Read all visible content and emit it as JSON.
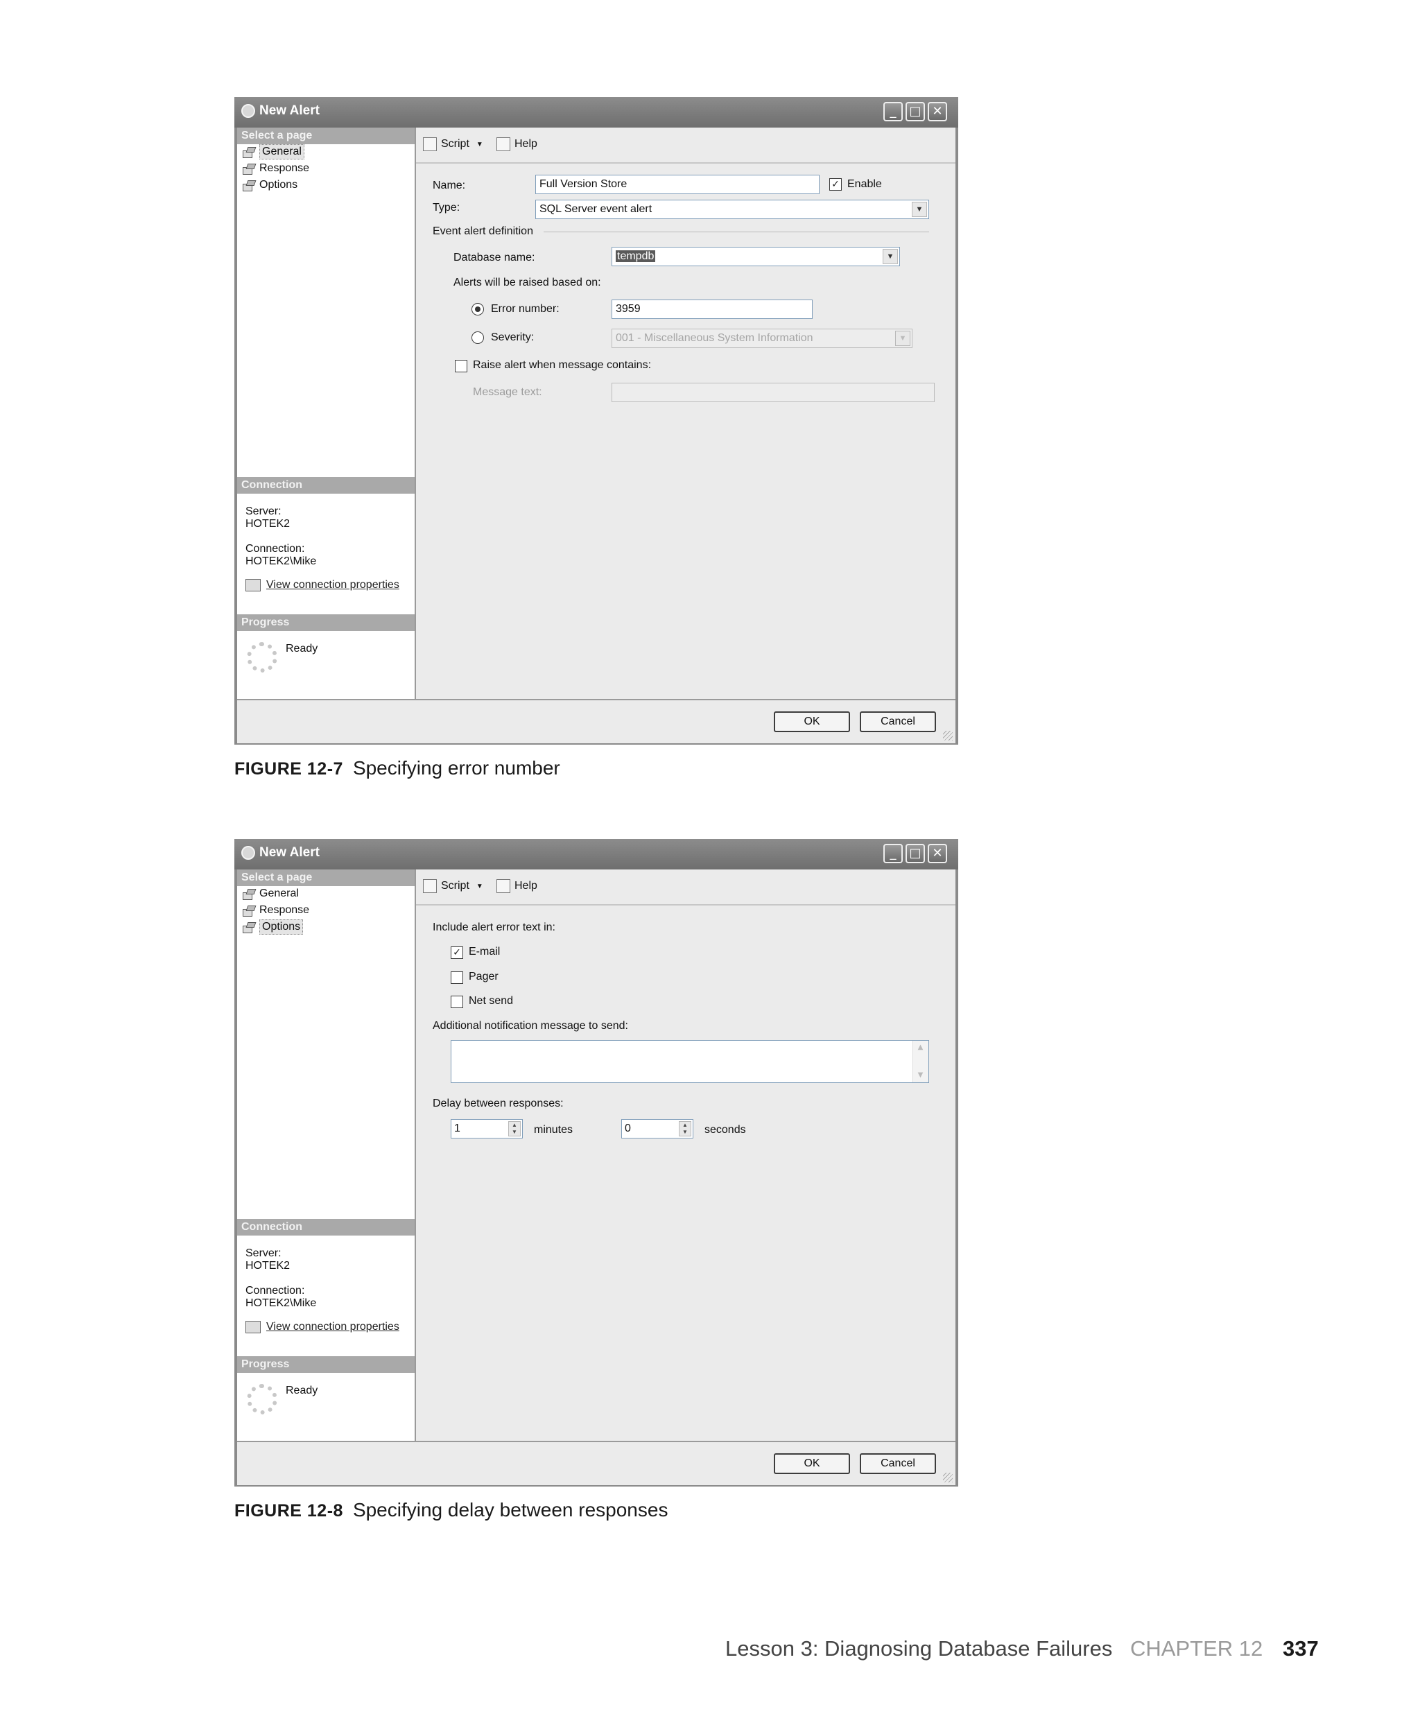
{
  "figure1": {
    "window_title": "New Alert",
    "select_page_header": "Select a page",
    "pages": [
      "General",
      "Response",
      "Options"
    ],
    "selected_page": "General",
    "toolbar": {
      "script_label": "Script",
      "help_label": "Help"
    },
    "connection_header": "Connection",
    "server_label": "Server:",
    "server_value": "HOTEK2",
    "connection_label": "Connection:",
    "connection_value": "HOTEK2\\Mike",
    "view_connection_link": "View connection properties",
    "progress_header": "Progress",
    "progress_status": "Ready",
    "form": {
      "name_label": "Name:",
      "name_value": "Full Version Store",
      "enable_label": "Enable",
      "enable_checked": true,
      "type_label": "Type:",
      "type_value": "SQL Server event alert",
      "event_alert_definition": "Event alert definition",
      "database_name_label": "Database name:",
      "database_name_value": "tempdb",
      "raised_based_on_label": "Alerts will be raised based on:",
      "error_number_label": "Error number:",
      "error_number_value": "3959",
      "severity_label": "Severity:",
      "severity_value": "001 - Miscellaneous System Information",
      "raise_alert_label": "Raise alert when message contains:",
      "message_text_label": "Message text:"
    },
    "ok_label": "OK",
    "cancel_label": "Cancel",
    "caption_label": "FIGURE 12-7",
    "caption_text": "Specifying error number"
  },
  "figure2": {
    "window_title": "New Alert",
    "select_page_header": "Select a page",
    "pages": [
      "General",
      "Response",
      "Options"
    ],
    "selected_page": "Options",
    "toolbar": {
      "script_label": "Script",
      "help_label": "Help"
    },
    "connection_header": "Connection",
    "server_label": "Server:",
    "server_value": "HOTEK2",
    "connection_label": "Connection:",
    "connection_value": "HOTEK2\\Mike",
    "view_connection_link": "View connection properties",
    "progress_header": "Progress",
    "progress_status": "Ready",
    "form": {
      "include_error_text_label": "Include alert error text in:",
      "email_label": "E-mail",
      "email_checked": true,
      "pager_label": "Pager",
      "net_send_label": "Net send",
      "additional_message_label": "Additional notification message to send:",
      "delay_label": "Delay between responses:",
      "minutes_value": "1",
      "minutes_label": "minutes",
      "seconds_value": "0",
      "seconds_label": "seconds"
    },
    "ok_label": "OK",
    "cancel_label": "Cancel",
    "caption_label": "FIGURE 12-8",
    "caption_text": "Specifying delay between responses"
  },
  "footer": {
    "lesson": "Lesson 3: Diagnosing Database Failures",
    "chapter": "CHAPTER 12",
    "page_number": "337"
  }
}
